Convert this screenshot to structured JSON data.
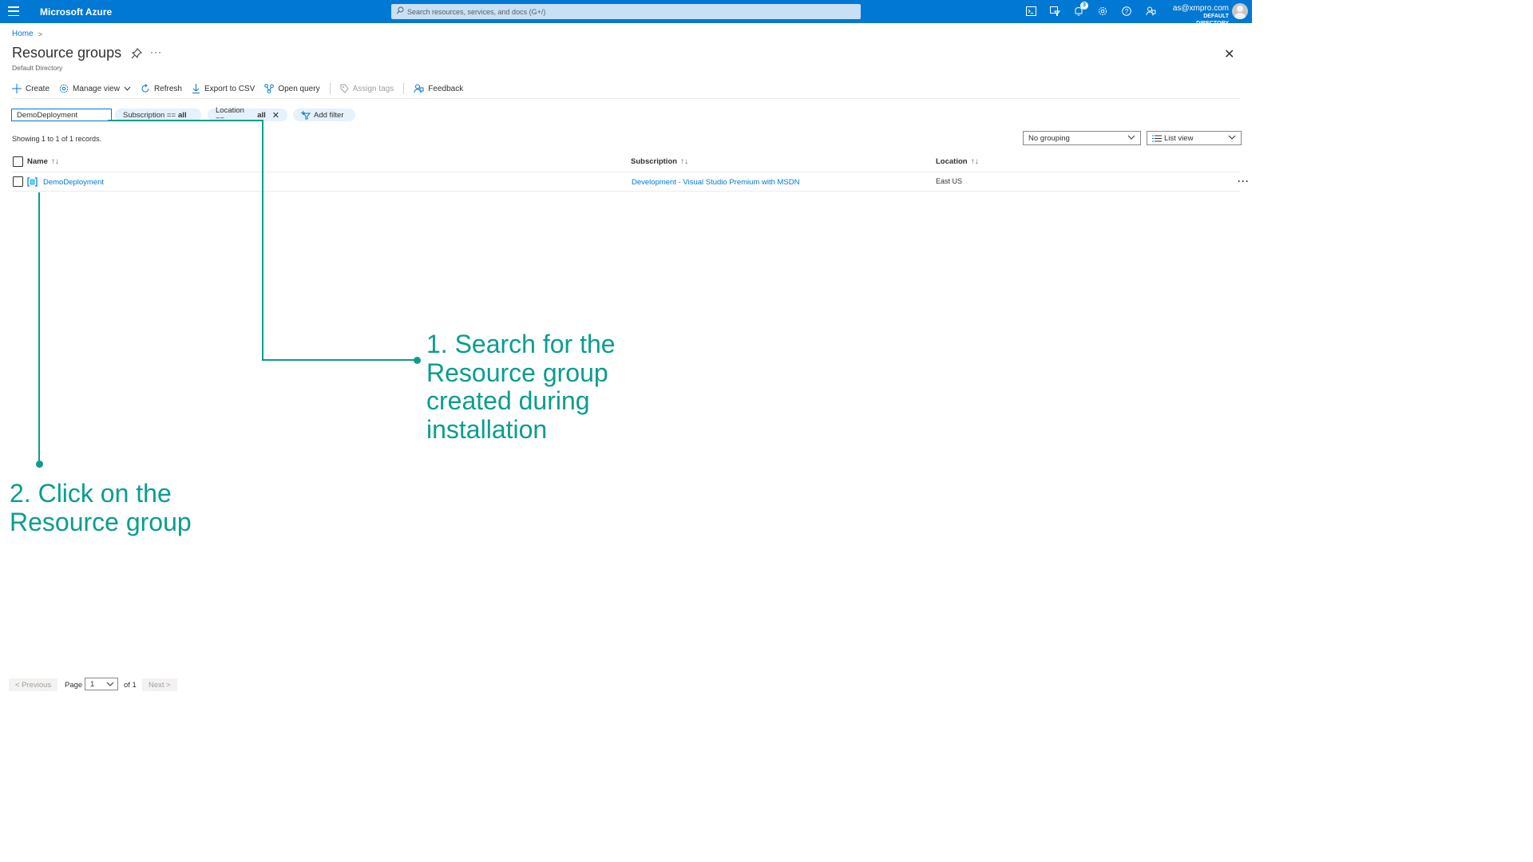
{
  "topbar": {
    "brand": "Microsoft Azure",
    "search_placeholder": "Search resources, services, and docs (G+/)",
    "notification_count": "3",
    "account_email": "as@xmpro.com",
    "account_directory": "DEFAULT DIRECTORY",
    "bg_color": "#0078d4",
    "icons": [
      "cloud-shell-icon",
      "directory-filter-icon",
      "notifications-icon",
      "settings-icon",
      "help-icon",
      "feedback-icon"
    ]
  },
  "breadcrumb": {
    "home": "Home",
    "separator": ">"
  },
  "header": {
    "title": "Resource groups",
    "subtitle": "Default Directory",
    "more": "···",
    "close": "✕"
  },
  "toolbar": {
    "create": "Create",
    "manage_view": "Manage view",
    "refresh": "Refresh",
    "export_csv": "Export to CSV",
    "open_query": "Open query",
    "assign_tags": "Assign tags",
    "feedback": "Feedback"
  },
  "filters": {
    "filter_value": "DemoDeployment",
    "subscription_label": "Subscription ==",
    "subscription_value": "all",
    "location_label": "Location ==",
    "location_value": "all",
    "add_filter": "Add filter"
  },
  "records_text": "Showing 1 to 1 of 1 records.",
  "grouping": {
    "selected": "No grouping"
  },
  "view": {
    "selected": "List view"
  },
  "table": {
    "columns": [
      "Name",
      "Subscription",
      "Location"
    ],
    "rows": [
      {
        "name": "DemoDeployment",
        "subscription": "Development - Visual Studio Premium with MSDN",
        "location": "East US"
      }
    ]
  },
  "annotations": {
    "color": "#0a9d8f",
    "step1": [
      "1. Search for the",
      "Resource group",
      "created during",
      "installation"
    ],
    "step2": [
      "2. Click on the",
      "Resource group"
    ]
  },
  "pagination": {
    "previous": "< Previous",
    "page_label": "Page",
    "page_value": "1",
    "of_label": "of 1",
    "next": "Next >"
  }
}
